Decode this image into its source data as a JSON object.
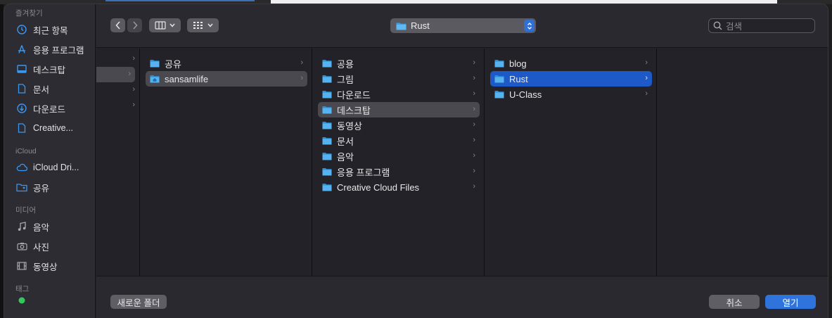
{
  "sidebar": {
    "favorites_label": "즐겨찾기",
    "favorites": [
      {
        "label": "최근 항목",
        "icon": "clock-icon"
      },
      {
        "label": "응용 프로그램",
        "icon": "apps-icon"
      },
      {
        "label": "데스크탑",
        "icon": "desktop-icon"
      },
      {
        "label": "문서",
        "icon": "document-icon"
      },
      {
        "label": "다운로드",
        "icon": "download-icon"
      },
      {
        "label": "Creative...",
        "icon": "file-icon"
      }
    ],
    "icloud_label": "iCloud",
    "icloud": [
      {
        "label": "iCloud Dri...",
        "icon": "cloud-icon"
      },
      {
        "label": "공유",
        "icon": "shared-folder-icon"
      }
    ],
    "media_label": "미디어",
    "media": [
      {
        "label": "음악",
        "icon": "music-icon"
      },
      {
        "label": "사진",
        "icon": "camera-icon"
      },
      {
        "label": "동영상",
        "icon": "film-icon"
      }
    ],
    "tags_label": "태그"
  },
  "toolbar": {
    "path_folder": "Rust",
    "search_placeholder": "검색"
  },
  "columns": {
    "col2": [
      {
        "label": "공유",
        "icon": "folder-icon"
      },
      {
        "label": "sansamlife",
        "icon": "home-folder-icon",
        "selected": "gray"
      }
    ],
    "col3": [
      {
        "label": "공용"
      },
      {
        "label": "그림"
      },
      {
        "label": "다운로드"
      },
      {
        "label": "데스크탑",
        "selected": "gray"
      },
      {
        "label": "동영상"
      },
      {
        "label": "문서"
      },
      {
        "label": "음악"
      },
      {
        "label": "응용 프로그램"
      },
      {
        "label": "Creative Cloud Files"
      }
    ],
    "col4": [
      {
        "label": "blog"
      },
      {
        "label": "Rust",
        "selected": "blue"
      },
      {
        "label": "U-Class"
      }
    ]
  },
  "footer": {
    "new_folder_label": "새로운 폴더",
    "cancel_label": "취소",
    "open_label": "열기"
  },
  "colors": {
    "accent": "#2f74dc",
    "folder": "#3aa0e8",
    "selection_blue": "#1d5ac7",
    "selection_gray": "#4a494f"
  }
}
